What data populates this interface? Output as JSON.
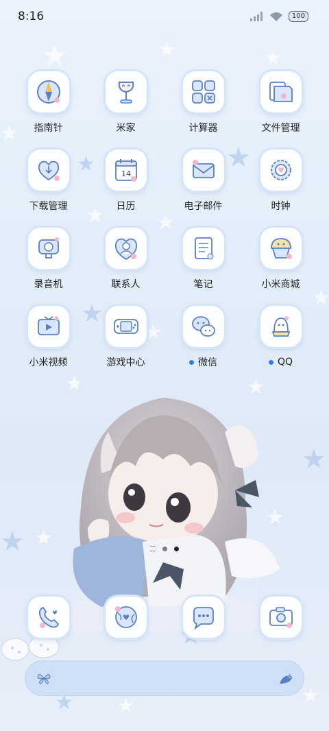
{
  "status_bar": {
    "time": "8:16",
    "battery": "100"
  },
  "apps": [
    {
      "label": "指南针",
      "icon": "compass-icon"
    },
    {
      "label": "米家",
      "icon": "lamp-icon"
    },
    {
      "label": "计算器",
      "icon": "calculator-icon"
    },
    {
      "label": "文件管理",
      "icon": "folder-icon"
    },
    {
      "label": "下载管理",
      "icon": "download-heart-icon"
    },
    {
      "label": "日历",
      "icon": "calendar-icon",
      "calendar_day": "14"
    },
    {
      "label": "电子邮件",
      "icon": "mail-icon"
    },
    {
      "label": "时钟",
      "icon": "clock-flower-icon"
    },
    {
      "label": "录音机",
      "icon": "recorder-icon"
    },
    {
      "label": "联系人",
      "icon": "contact-heart-icon"
    },
    {
      "label": "笔记",
      "icon": "notes-icon"
    },
    {
      "label": "小米商城",
      "icon": "cupcake-shop-icon"
    },
    {
      "label": "小米视频",
      "icon": "tv-play-icon"
    },
    {
      "label": "游戏中心",
      "icon": "game-console-icon"
    },
    {
      "label": "微信",
      "icon": "chat-bubbles-icon",
      "new_dot": true
    },
    {
      "label": "QQ",
      "icon": "penguin-icon",
      "new_dot": true
    }
  ],
  "dock": [
    {
      "icon": "phone-heart-icon"
    },
    {
      "icon": "globe-heart-icon"
    },
    {
      "icon": "message-bubble-icon"
    },
    {
      "icon": "camera-icon"
    }
  ],
  "search_bar": {
    "left_icon": "butterfly-icon",
    "right_icon": "bird-icon"
  },
  "colors": {
    "accent": "#2f7de9",
    "icon_stroke": "#5b7fc4",
    "icon_fill": "#d9e6fb",
    "tile_ring": "#d6e4f8"
  }
}
